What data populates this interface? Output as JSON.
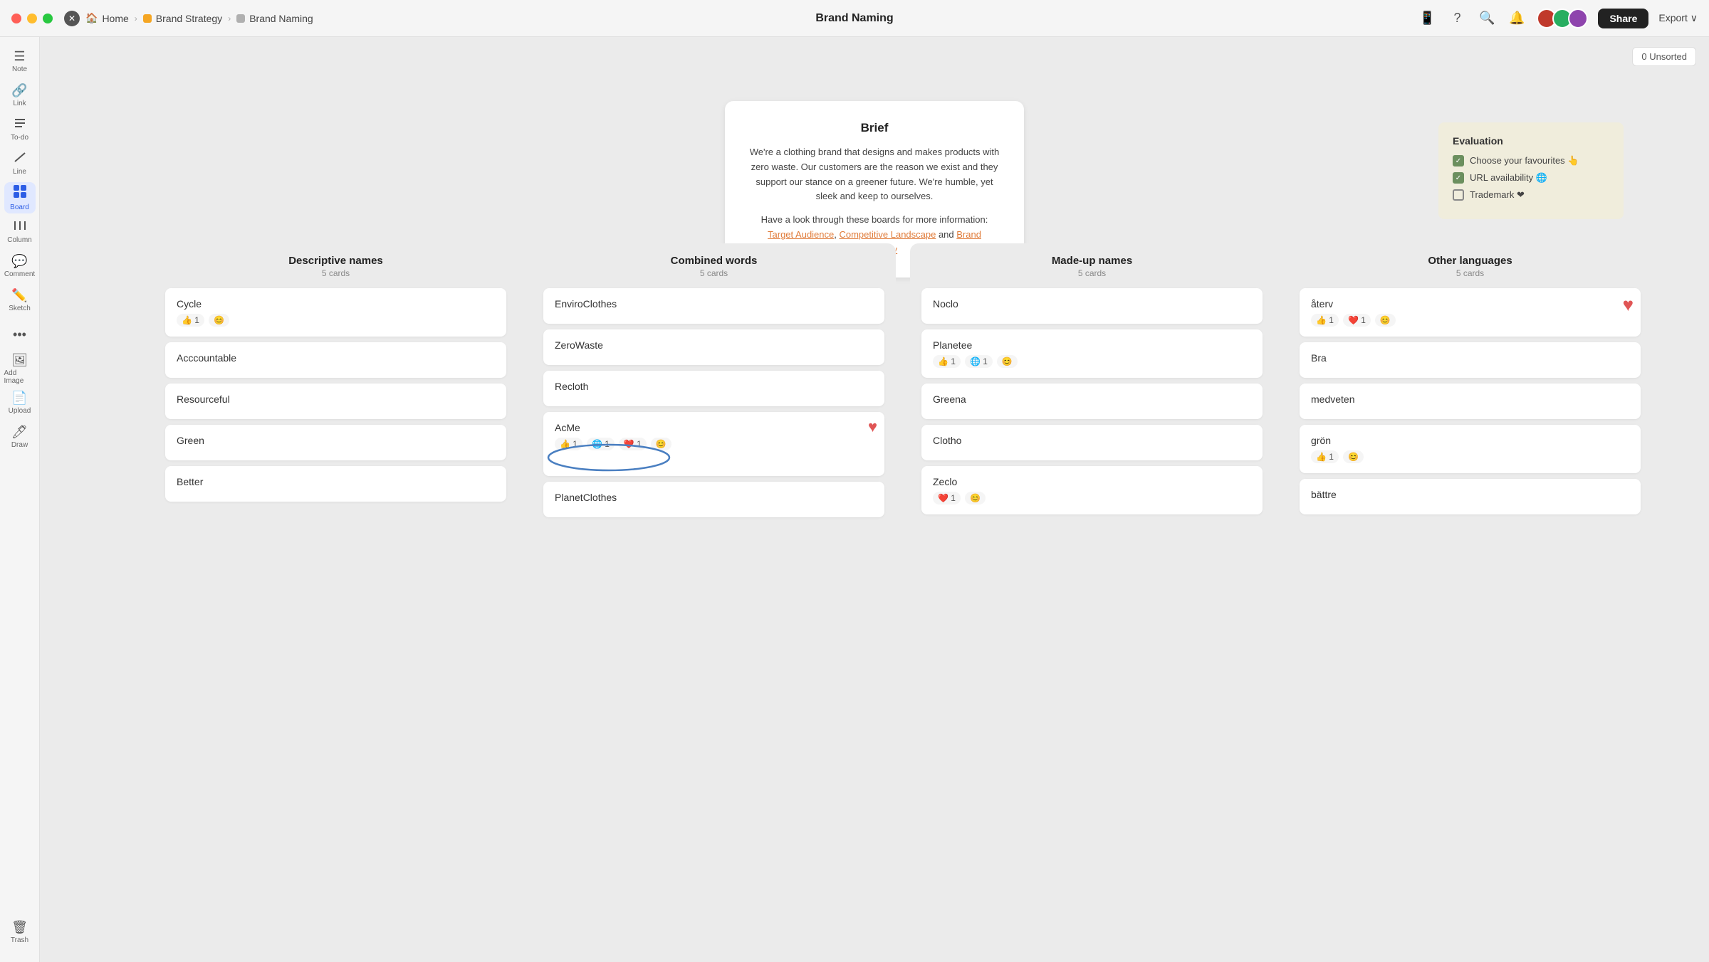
{
  "titlebar": {
    "title": "Brand Naming",
    "breadcrumb": [
      {
        "label": "Home",
        "type": "home"
      },
      {
        "label": "Brand Strategy",
        "type": "orange"
      },
      {
        "label": "Brand Naming",
        "type": "gray"
      }
    ],
    "share_label": "Share",
    "export_label": "Export ∨",
    "notification_count": "0"
  },
  "sidebar": {
    "items": [
      {
        "id": "note",
        "icon": "☰",
        "label": "Note"
      },
      {
        "id": "link",
        "icon": "🔗",
        "label": "Link"
      },
      {
        "id": "todo",
        "icon": "≡",
        "label": "To-do"
      },
      {
        "id": "line",
        "icon": "/",
        "label": "Line"
      },
      {
        "id": "board",
        "icon": "⊞",
        "label": "Board",
        "active": true
      },
      {
        "id": "column",
        "icon": "⋮⋮⋮",
        "label": "Column"
      },
      {
        "id": "comment",
        "icon": "💬",
        "label": "Comment"
      },
      {
        "id": "sketch",
        "icon": "✏",
        "label": "Sketch"
      },
      {
        "id": "more",
        "icon": "•••",
        "label": ""
      },
      {
        "id": "addimage",
        "icon": "🖼",
        "label": "Add Image"
      },
      {
        "id": "upload",
        "icon": "📄",
        "label": "Upload"
      },
      {
        "id": "draw",
        "icon": "🖊",
        "label": "Draw"
      }
    ],
    "trash_label": "Trash"
  },
  "sort_label": "0 Unsorted",
  "brief": {
    "title": "Brief",
    "text1": "We're a clothing brand that designs and makes products with zero waste. Our customers are the reason we exist and they support our stance on a greener future. We're humble, yet sleek and keep to ourselves.",
    "text2": "Have a look through these boards for more information:",
    "links": [
      "Target Audience",
      "Competitive Landscape",
      "Brand Personality"
    ]
  },
  "evaluation": {
    "title": "Evaluation",
    "items": [
      {
        "label": "Choose your favourites 👆",
        "checked": true
      },
      {
        "label": "URL availability 🌐",
        "checked": true
      },
      {
        "label": "Trademark ❤",
        "checked": false
      }
    ]
  },
  "columns": [
    {
      "id": "descriptive",
      "title": "Descriptive names",
      "count": "5 cards",
      "cards": [
        {
          "name": "Cycle",
          "reactions": [
            {
              "emoji": "👍",
              "count": "1"
            },
            {
              "emoji": "😊",
              "count": ""
            }
          ]
        },
        {
          "name": "Acccountable",
          "reactions": []
        },
        {
          "name": "Resourceful",
          "reactions": []
        },
        {
          "name": "Green",
          "reactions": []
        },
        {
          "name": "Better",
          "reactions": []
        }
      ]
    },
    {
      "id": "combined",
      "title": "Combined words",
      "count": "5 cards",
      "cards": [
        {
          "name": "EnviroClothes",
          "reactions": []
        },
        {
          "name": "ZeroWaste",
          "reactions": []
        },
        {
          "name": "Recloth",
          "reactions": []
        },
        {
          "name": "AcMe",
          "reactions": [
            {
              "emoji": "👍",
              "count": "1"
            },
            {
              "emoji": "🌐",
              "count": "1"
            },
            {
              "emoji": "❤️",
              "count": "1"
            },
            {
              "emoji": "😊",
              "count": ""
            }
          ],
          "heart": true,
          "circled": true
        },
        {
          "name": "PlanetClothes",
          "reactions": []
        }
      ]
    },
    {
      "id": "madeup",
      "title": "Made-up names",
      "count": "5 cards",
      "cards": [
        {
          "name": "Noclo",
          "reactions": []
        },
        {
          "name": "Planetee",
          "reactions": [
            {
              "emoji": "👍",
              "count": "1"
            },
            {
              "emoji": "🌐",
              "count": "1"
            },
            {
              "emoji": "😊",
              "count": ""
            }
          ]
        },
        {
          "name": "Greena",
          "reactions": []
        },
        {
          "name": "Clotho",
          "reactions": []
        },
        {
          "name": "Zeclo",
          "reactions": [
            {
              "emoji": "❤️",
              "count": "1"
            },
            {
              "emoji": "😊",
              "count": ""
            }
          ]
        }
      ]
    },
    {
      "id": "otherlang",
      "title": "Other languages",
      "count": "5 cards",
      "cards": [
        {
          "name": "återv",
          "reactions": [
            {
              "emoji": "👍",
              "count": "1"
            },
            {
              "emoji": "❤️",
              "count": "1"
            },
            {
              "emoji": "😊",
              "count": ""
            }
          ],
          "heart": true
        },
        {
          "name": "Bra",
          "reactions": []
        },
        {
          "name": "medveten",
          "reactions": []
        },
        {
          "name": "grön",
          "reactions": [
            {
              "emoji": "👍",
              "count": "1"
            },
            {
              "emoji": "😊",
              "count": ""
            }
          ]
        },
        {
          "name": "bättre",
          "reactions": []
        }
      ]
    }
  ]
}
